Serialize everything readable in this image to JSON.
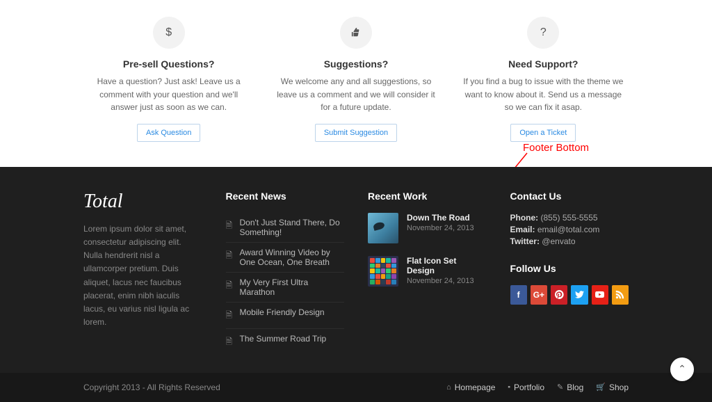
{
  "features": [
    {
      "title": "Pre-sell Questions?",
      "text": "Have a question? Just ask! Leave us a comment with your question and we'll answer just as soon as we can.",
      "button": "Ask Question"
    },
    {
      "title": "Suggestions?",
      "text": "We welcome any and all suggestions, so leave us a comment and we will consider it for a future update.",
      "button": "Submit Suggestion"
    },
    {
      "title": "Need Support?",
      "text": "If you find a bug to issue with the theme we want to know about it. Send us a message so we can fix it asap.",
      "button": "Open a Ticket"
    }
  ],
  "annotation": {
    "label": "Footer Bottom"
  },
  "footer": {
    "brand": "Total",
    "about": "Lorem ipsum dolor sit amet, consectetur adipiscing elit. Nulla hendrerit nisl a ullamcorper pretium. Duis aliquet, lacus nec faucibus placerat, enim nibh iaculis lacus, eu varius nisl ligula ac lorem.",
    "newsHeading": "Recent News",
    "news": [
      "Don't Just Stand There, Do Something!",
      "Award Winning Video by One Ocean, One Breath",
      "My Very First Ultra Marathon",
      "Mobile Friendly Design",
      "The Summer Road Trip"
    ],
    "workHeading": "Recent Work",
    "work": [
      {
        "title": "Down The Road",
        "date": "November 24, 2013"
      },
      {
        "title": "Flat Icon Set Design",
        "date": "November 24, 2013"
      }
    ],
    "contactHeading": "Contact Us",
    "contact": {
      "phoneLabel": "Phone:",
      "phone": "(855) 555-5555",
      "emailLabel": "Email:",
      "email": "email@total.com",
      "twitterLabel": "Twitter:",
      "twitter": "@envato"
    },
    "followHeading": "Follow Us"
  },
  "bottom": {
    "copyright": "Copyright 2013 - All Rights Reserved",
    "nav": {
      "home": "Homepage",
      "portfolio": "Portfolio",
      "blog": "Blog",
      "shop": "Shop"
    }
  }
}
